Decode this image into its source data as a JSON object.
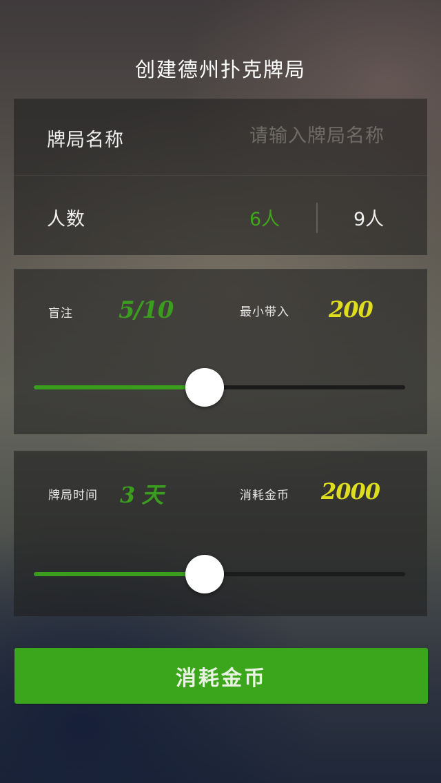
{
  "header": {
    "title": "创建德州扑克牌局"
  },
  "table_settings": {
    "name_label": "牌局名称",
    "name_value": "",
    "name_placeholder": "请输入牌局名称",
    "players_label": "人数",
    "player_options": [
      "6人",
      "9人"
    ],
    "selected_option": "6人"
  },
  "blinds_panel": {
    "blind_label": "盲注",
    "blind_value": "5/10",
    "min_buyin_label": "最小带入",
    "min_buyin_value": "200",
    "slider_value": 0.46
  },
  "duration_panel": {
    "duration_label": "牌局时间",
    "duration_value": "3 天",
    "cost_label": "消耗金币",
    "cost_value": "2000",
    "slider_value": 0.46
  },
  "cta": {
    "label": "消耗金币"
  },
  "colors": {
    "accent_green": "#3ba51b",
    "accent_yellow": "#dede1e"
  }
}
